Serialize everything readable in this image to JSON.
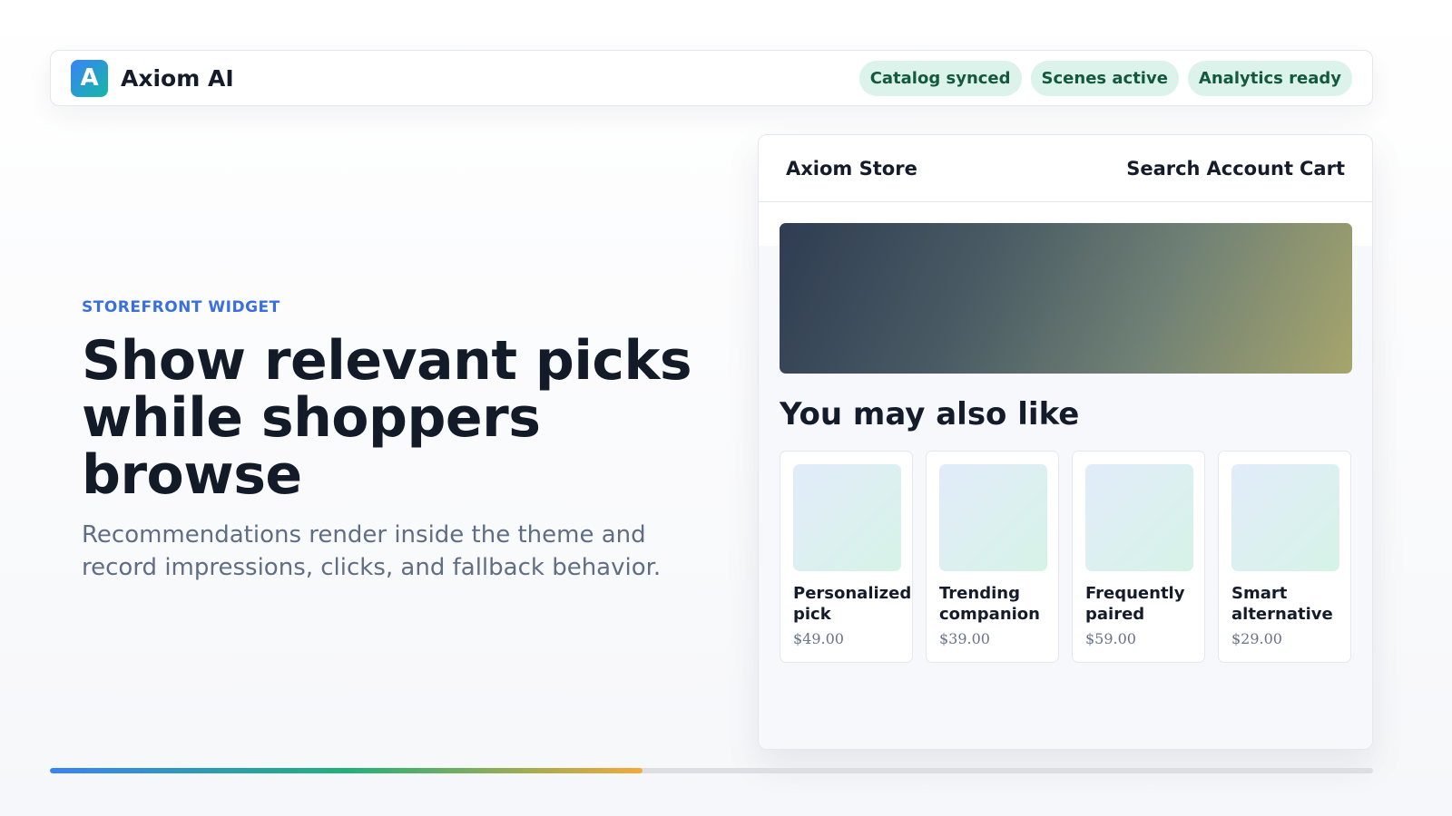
{
  "topbar": {
    "logo_letter": "A",
    "brand_name": "Axiom AI",
    "pills": [
      "Catalog synced",
      "Scenes active",
      "Analytics ready"
    ]
  },
  "hero": {
    "eyebrow": "STOREFRONT WIDGET",
    "headline": "Show relevant picks while shoppers browse",
    "subtext": "Recommendations render inside the theme and record impressions, clicks, and fallback behavior."
  },
  "store": {
    "name": "Axiom Store",
    "nav": [
      "Search",
      "Account",
      "Cart"
    ],
    "section_title": "You may also like",
    "products": [
      {
        "title": "Personalized pick",
        "price": "$49.00"
      },
      {
        "title": "Trending companion",
        "price": "$39.00"
      },
      {
        "title": "Frequently paired",
        "price": "$59.00"
      },
      {
        "title": "Smart alternative",
        "price": "$29.00"
      }
    ]
  },
  "progress": {
    "value": 0.448
  },
  "colors": {
    "accent": "#3b6fe0",
    "pill_bg": "#dbf3ea",
    "pill_text": "#14593f"
  }
}
